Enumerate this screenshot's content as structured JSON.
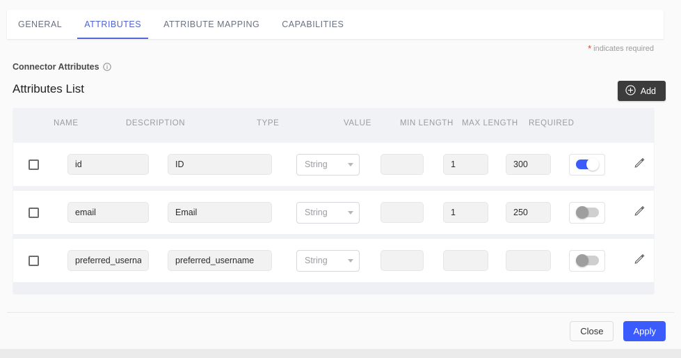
{
  "tabs": [
    {
      "label": "GENERAL",
      "active": false
    },
    {
      "label": "ATTRIBUTES",
      "active": true
    },
    {
      "label": "ATTRIBUTE MAPPING",
      "active": false
    },
    {
      "label": "CAPABILITIES",
      "active": false
    }
  ],
  "required_note": {
    "star": "*",
    "text": "indicates required"
  },
  "section": {
    "connector_attributes_label": "Connector Attributes",
    "info_icon": "info-icon",
    "attributes_list_title": "Attributes List"
  },
  "add_button": {
    "label": "Add",
    "icon": "plus-circle-icon"
  },
  "table": {
    "columns": [
      "NAME",
      "DESCRIPTION",
      "TYPE",
      "VALUE",
      "MIN LENGTH",
      "MAX LENGTH",
      "REQUIRED"
    ],
    "rows": [
      {
        "checked": false,
        "name": "id",
        "description": "ID",
        "type": "String",
        "value": "",
        "min_length": "1",
        "max_length": "300",
        "required": true,
        "edit_icon": "pencil-icon"
      },
      {
        "checked": false,
        "name": "email",
        "description": "Email",
        "type": "String",
        "value": "",
        "min_length": "1",
        "max_length": "250",
        "required": false,
        "edit_icon": "pencil-icon"
      },
      {
        "checked": false,
        "name": "preferred_username",
        "description": "preferred_username",
        "type": "String",
        "value": "",
        "min_length": "",
        "max_length": "",
        "required": false,
        "edit_icon": "pencil-icon"
      }
    ]
  },
  "footer": {
    "close_label": "Close",
    "apply_label": "Apply"
  },
  "colors": {
    "accent_blue": "#3b5bfd",
    "tab_active": "#4f63d2",
    "required_star": "#e53935",
    "add_button_bg": "#3c3c3c"
  }
}
